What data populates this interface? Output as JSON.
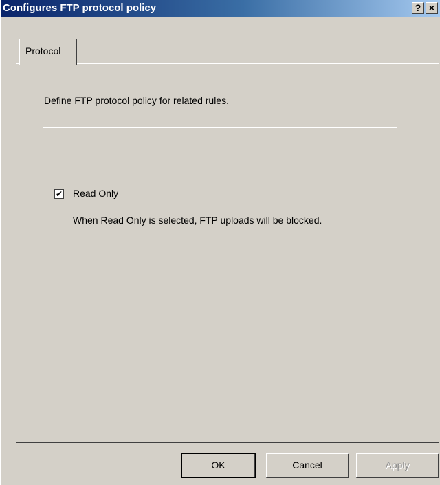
{
  "window": {
    "title": "Configures FTP protocol policy",
    "help_label": "?",
    "close_label": "×"
  },
  "tabs": [
    {
      "label": "Protocol",
      "selected": true
    }
  ],
  "panel": {
    "description": "Define FTP protocol policy for related rules.",
    "read_only": {
      "label": "Read Only",
      "checked": true,
      "check_glyph": "✔",
      "hint": "When Read Only is selected, FTP uploads will be blocked."
    }
  },
  "buttons": {
    "ok": "OK",
    "cancel": "Cancel",
    "apply": "Apply",
    "apply_enabled": false
  },
  "colors": {
    "title_bar": "#0a246a",
    "face": "#d4d0c8",
    "disabled_text": "#8c8c8c"
  },
  "icons": [
    "help-icon",
    "close-icon",
    "checkmark-icon"
  ]
}
